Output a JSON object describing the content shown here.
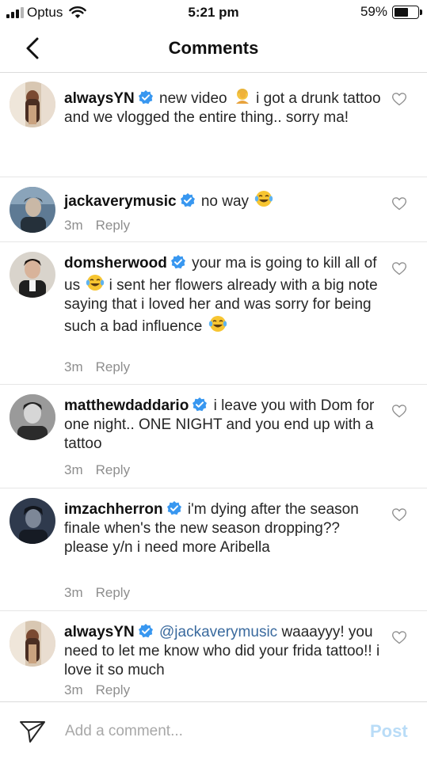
{
  "status": {
    "carrier": "Optus",
    "time": "5:21 pm",
    "battery_percent": "59%",
    "battery_level": 0.59
  },
  "header": {
    "title": "Comments"
  },
  "comments": [
    {
      "username": "alwaysYN",
      "verified": true,
      "text": "new video",
      "emoji": "person-facepalming",
      "text2": "i got a drunk tattoo and we vlogged the entire thing.. sorry ma!",
      "is_caption": true
    },
    {
      "username": "jackaverymusic",
      "verified": true,
      "text": "no way",
      "emoji": "laughing-crying",
      "time": "3m",
      "reply": "Reply"
    },
    {
      "username": "domsherwood",
      "verified": true,
      "text": "your ma is going to kill all of us",
      "emoji": "laughing-crying",
      "text2": "i sent her flowers already with a big note saying that i loved her and was sorry for being such a bad influence",
      "emoji2": "laughing-crying",
      "time": "3m",
      "reply": "Reply"
    },
    {
      "username": "matthewdaddario",
      "verified": true,
      "text": "i leave you with Dom for one night.. ONE NIGHT and you end up with a tattoo",
      "time": "3m",
      "reply": "Reply"
    },
    {
      "username": "imzachherron",
      "verified": true,
      "text": "i'm dying after the season finale when's the new season dropping?? please y/n i need more Aribella",
      "time": "3m",
      "reply": "Reply"
    },
    {
      "username": "alwaysYN",
      "verified": true,
      "mention": "@jackaverymusic",
      "text": "waaayyy! you need to let me know who did your frida tattoo!! i love it so much",
      "time": "3m",
      "reply": "Reply"
    }
  ],
  "composer": {
    "placeholder": "Add a comment...",
    "post_label": "Post"
  },
  "colors": {
    "verified": "#3897f0",
    "post_disabled": "#b9dcf7",
    "meta_gray": "#8e8e8e",
    "mention": "#3a6a9e"
  }
}
